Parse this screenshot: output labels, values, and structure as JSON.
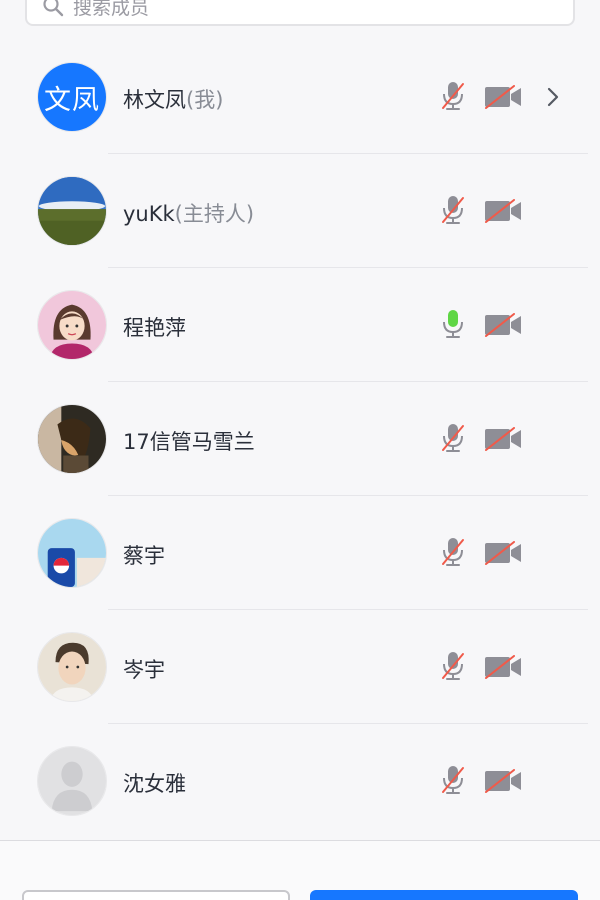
{
  "search": {
    "placeholder": "搜索成员"
  },
  "members": [
    {
      "avatar_text": "文凤",
      "name": "林文凤",
      "role": "(我)",
      "mic": "muted",
      "camera": "off",
      "has_chevron": true
    },
    {
      "avatar_text": "",
      "name": "yuKk",
      "role": "(主持人)",
      "mic": "muted",
      "camera": "off",
      "has_chevron": false
    },
    {
      "avatar_text": "",
      "name": "程艳萍",
      "role": "",
      "mic": "active",
      "camera": "off",
      "has_chevron": false
    },
    {
      "avatar_text": "",
      "name": "17信管马雪兰",
      "role": "",
      "mic": "muted",
      "camera": "off",
      "has_chevron": false
    },
    {
      "avatar_text": "",
      "name": "蔡宇",
      "role": "",
      "mic": "muted",
      "camera": "off",
      "has_chevron": false
    },
    {
      "avatar_text": "",
      "name": "岑宇",
      "role": "",
      "mic": "muted",
      "camera": "off",
      "has_chevron": false
    },
    {
      "avatar_text": "",
      "name": "沈女雅",
      "role": "",
      "mic": "muted",
      "camera": "off",
      "has_chevron": false
    }
  ],
  "colors": {
    "accent": "#1677ff",
    "mic_active": "#5fd645",
    "mute_slash": "#f05a4a",
    "icon_gray": "#8e8e96"
  }
}
